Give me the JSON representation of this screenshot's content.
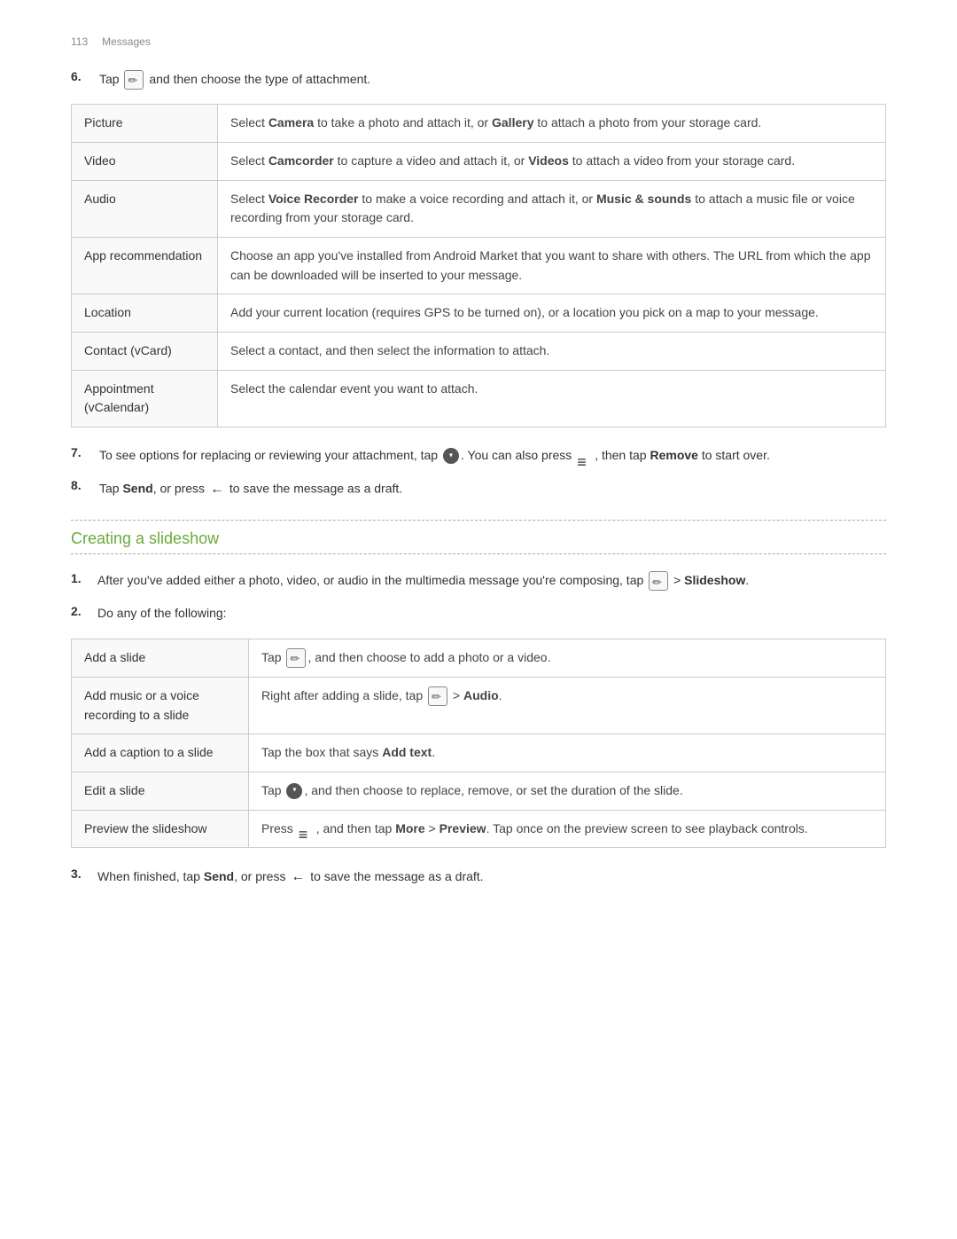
{
  "header": {
    "page_number": "113",
    "title": "Messages"
  },
  "step6": {
    "prefix": "Tap",
    "suffix": "and then choose the type of attachment."
  },
  "attachment_table": {
    "rows": [
      {
        "label": "Picture",
        "description": "Select Camera to take a photo and attach it, or Gallery to attach a photo from your storage card."
      },
      {
        "label": "Video",
        "description": "Select Camcorder to capture a video and attach it, or Videos to attach a video from your storage card."
      },
      {
        "label": "Audio",
        "description": "Select Voice Recorder to make a voice recording and attach it, or Music & sounds to attach a music file or voice recording from your storage card."
      },
      {
        "label": "App recommendation",
        "description": "Choose an app you've installed from Android Market that you want to share with others. The URL from which the app can be downloaded will be inserted to your message."
      },
      {
        "label": "Location",
        "description": "Add your current location (requires GPS to be turned on), or a location you pick on a map to your message."
      },
      {
        "label": "Contact (vCard)",
        "description": "Select a contact, and then select the information to attach."
      },
      {
        "label": "Appointment (vCalendar)",
        "description": "Select the calendar event you want to attach."
      }
    ]
  },
  "step7": {
    "text": "To see options for replacing or reviewing your attachment, tap",
    "text2": ". You can also press",
    "text3": ", then tap",
    "remove_label": "Remove",
    "text4": "to start over."
  },
  "step8": {
    "prefix": "Tap",
    "send_label": "Send",
    "middle": ", or press",
    "suffix": "to save the message as a draft."
  },
  "section_heading": "Creating a slideshow",
  "slideshow_step1": {
    "prefix": "After you've added either a photo, video, or audio in the multimedia message you're composing, tap",
    "middle": " >",
    "slideshow_label": "Slideshow",
    "suffix": "."
  },
  "slideshow_step2": {
    "text": "Do any of the following:"
  },
  "slideshow_table": {
    "rows": [
      {
        "label": "Add a slide",
        "description": "Tap",
        "description2": ", and then choose to add a photo or a video."
      },
      {
        "label": "Add music or a voice recording to a slide",
        "description": "Right after adding a slide, tap",
        "description2": " > Audio."
      },
      {
        "label": "Add a caption to a slide",
        "description": "Tap the box that says",
        "add_text_label": "Add text",
        "description2": "."
      },
      {
        "label": "Edit a slide",
        "description": "Tap",
        "description2": ", and then choose to replace, remove, or set the duration of the slide."
      },
      {
        "label": "Preview the slideshow",
        "description": "Press",
        "description2": ", and then tap",
        "more_label": "More",
        "description3": " >",
        "preview_label": "Preview",
        "description4": ". Tap once on the preview screen to see playback controls."
      }
    ]
  },
  "slideshow_step3": {
    "prefix": "When finished, tap",
    "send_label": "Send",
    "middle": ", or press",
    "suffix": "to save the message as a draft."
  }
}
